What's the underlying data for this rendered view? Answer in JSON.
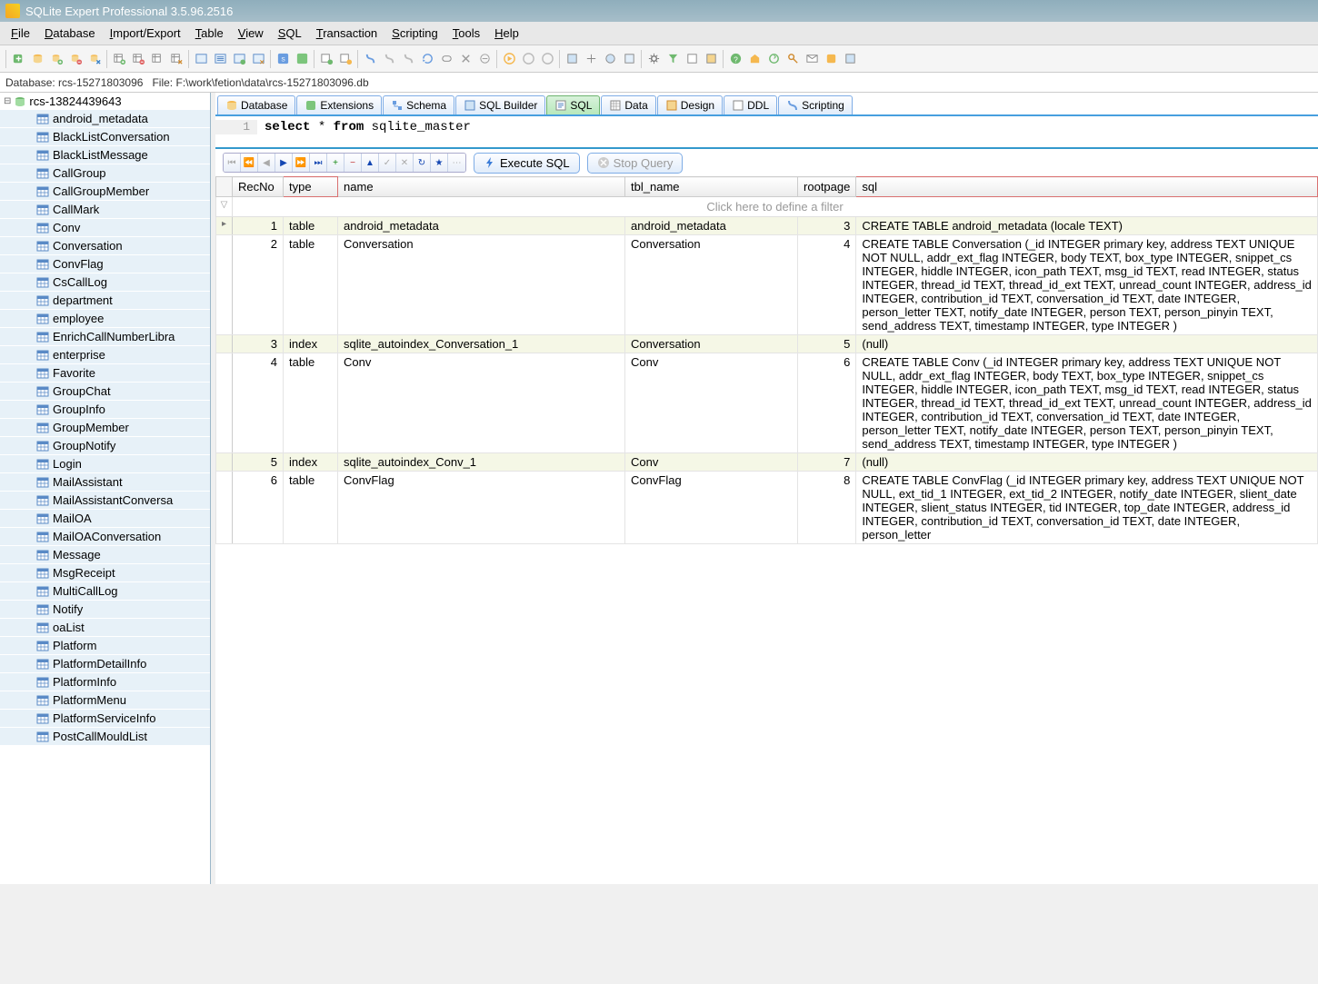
{
  "title": "SQLite Expert Professional 3.5.96.2516",
  "menu": [
    "File",
    "Database",
    "Import/Export",
    "Table",
    "View",
    "SQL",
    "Transaction",
    "Scripting",
    "Tools",
    "Help"
  ],
  "status": {
    "db_label": "Database:",
    "db": "rcs-15271803096",
    "file_label": "File:",
    "file": "F:\\work\\fetion\\data\\rcs-15271803096.db"
  },
  "tree": {
    "root": "rcs-13824439643",
    "items": [
      "android_metadata",
      "BlackListConversation",
      "BlackListMessage",
      "CallGroup",
      "CallGroupMember",
      "CallMark",
      "Conv",
      "Conversation",
      "ConvFlag",
      "CsCallLog",
      "department",
      "employee",
      "EnrichCallNumberLibra",
      "enterprise",
      "Favorite",
      "GroupChat",
      "GroupInfo",
      "GroupMember",
      "GroupNotify",
      "Login",
      "MailAssistant",
      "MailAssistantConversa",
      "MailOA",
      "MailOAConversation",
      "Message",
      "MsgReceipt",
      "MultiCallLog",
      "Notify",
      "oaList",
      "Platform",
      "PlatformDetailInfo",
      "PlatformInfo",
      "PlatformMenu",
      "PlatformServiceInfo",
      "PostCallMouldList"
    ]
  },
  "tabs": [
    "Database",
    "Extensions",
    "Schema",
    "SQL Builder",
    "SQL",
    "Data",
    "Design",
    "DDL",
    "Scripting"
  ],
  "active_tab": 4,
  "sql": {
    "line": "1",
    "code_kw1": "select",
    "code_star": " * ",
    "code_kw2": "from",
    "code_rest": " sqlite_master"
  },
  "gridbar": {
    "exec": "Execute SQL",
    "stop": "Stop Query"
  },
  "grid": {
    "headers": [
      "RecNo",
      "type",
      "name",
      "tbl_name",
      "rootpage",
      "sql"
    ],
    "filter_hint": "Click here to define a filter",
    "rows": [
      {
        "rec": 1,
        "type": "table",
        "name": "android_metadata",
        "tbl": "android_metadata",
        "root": 3,
        "sql": "CREATE TABLE android_metadata (locale TEXT)"
      },
      {
        "rec": 2,
        "type": "table",
        "name": "Conversation",
        "tbl": "Conversation",
        "root": 4,
        "sql": "CREATE TABLE Conversation (_id INTEGER primary key, address TEXT UNIQUE NOT NULL, addr_ext_flag INTEGER, body TEXT, box_type INTEGER, snippet_cs INTEGER, hiddle INTEGER, icon_path TEXT, msg_id TEXT, read INTEGER, status INTEGER, thread_id TEXT, thread_id_ext TEXT, unread_count INTEGER, address_id INTEGER, contribution_id TEXT, conversation_id TEXT, date INTEGER, person_letter TEXT, notify_date INTEGER, person TEXT, person_pinyin TEXT, send_address TEXT, timestamp INTEGER, type INTEGER )"
      },
      {
        "rec": 3,
        "type": "index",
        "name": "sqlite_autoindex_Conversation_1",
        "tbl": "Conversation",
        "root": 5,
        "sql": "(null)"
      },
      {
        "rec": 4,
        "type": "table",
        "name": "Conv",
        "tbl": "Conv",
        "root": 6,
        "sql": "CREATE TABLE Conv (_id INTEGER primary key, address TEXT UNIQUE NOT NULL, addr_ext_flag INTEGER, body TEXT, box_type INTEGER, snippet_cs INTEGER, hiddle INTEGER, icon_path TEXT, msg_id TEXT, read INTEGER, status INTEGER, thread_id TEXT, thread_id_ext TEXT, unread_count INTEGER, address_id INTEGER, contribution_id TEXT, conversation_id TEXT, date INTEGER, person_letter TEXT, notify_date INTEGER, person TEXT, person_pinyin TEXT, send_address TEXT, timestamp INTEGER, type INTEGER )"
      },
      {
        "rec": 5,
        "type": "index",
        "name": "sqlite_autoindex_Conv_1",
        "tbl": "Conv",
        "root": 7,
        "sql": "(null)"
      },
      {
        "rec": 6,
        "type": "table",
        "name": "ConvFlag",
        "tbl": "ConvFlag",
        "root": 8,
        "sql": "CREATE TABLE ConvFlag (_id INTEGER primary key, address TEXT UNIQUE NOT NULL, ext_tid_1 INTEGER, ext_tid_2 INTEGER, notify_date INTEGER, slient_date INTEGER, slient_status INTEGER, tid INTEGER, top_date INTEGER, address_id INTEGER, contribution_id TEXT, conversation_id TEXT, date INTEGER, person_letter"
      }
    ]
  }
}
